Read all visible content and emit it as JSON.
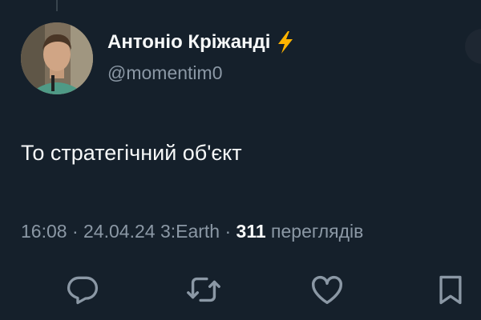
{
  "tweet": {
    "author": {
      "display_name": "Антоніо Кріжанді",
      "name_emoji": "lightning-emoji",
      "handle": "@momentim0",
      "avatar": "profile-photo"
    },
    "text": "То стратегічний об'єкт",
    "meta": {
      "time": "16:08",
      "sep1": " · ",
      "date": "24.04.24",
      "source": "3:Earth",
      "sep2": " · ",
      "views_count": "311",
      "views_label": "переглядів"
    },
    "actions": {
      "reply_icon": "reply-icon",
      "retweet_icon": "retweet-icon",
      "like_icon": "like-icon",
      "bookmark_icon": "bookmark-icon"
    }
  },
  "colors": {
    "background": "#15202b",
    "primary_text": "#f7f9f9",
    "secondary_text": "#8b98a5",
    "bolt": "#ffb400"
  }
}
